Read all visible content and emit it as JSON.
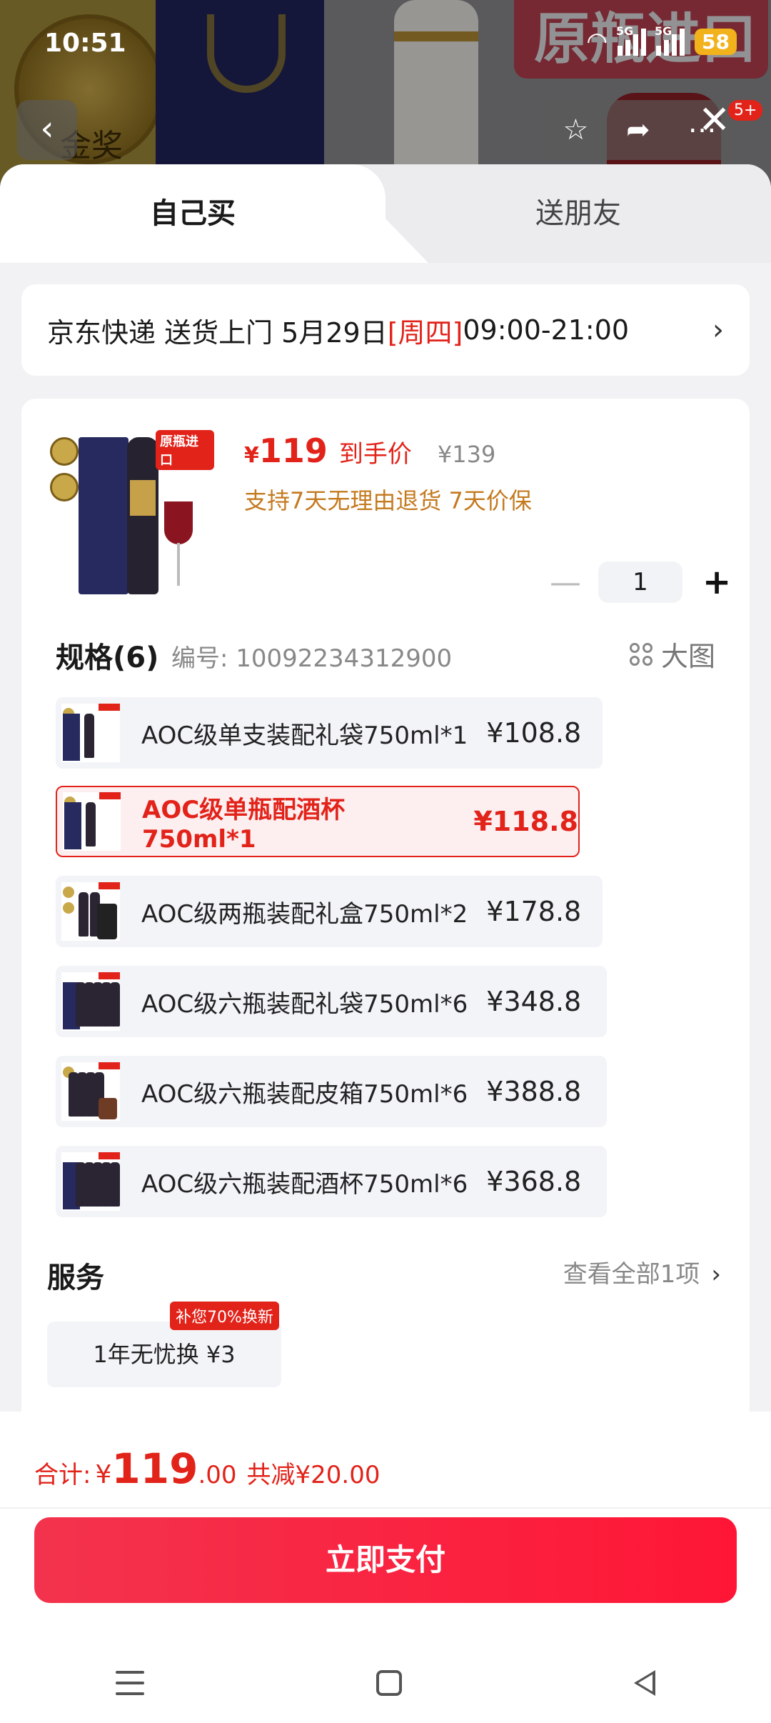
{
  "status_bar": {
    "time": "10:51",
    "battery": "58",
    "signal_labels": [
      "5G",
      "5G"
    ]
  },
  "background": {
    "badge_text": "原瓶进口",
    "medal_text": "金奖",
    "cart_count": "5+"
  },
  "tabs": [
    {
      "label": "自己买",
      "active": true
    },
    {
      "label": "送朋友",
      "active": false
    }
  ],
  "delivery": {
    "prefix": "京东快递 送货上门 5月29日 ",
    "weekday": "[周四]",
    "time_window": " 09:00-21:00"
  },
  "product": {
    "image_tag": "原瓶进口",
    "price_symbol": "¥",
    "price": "119",
    "price_note": "到手价",
    "original_price": "¥139",
    "guarantee": "支持7天无理由退货 7天价保",
    "quantity": "1"
  },
  "spec": {
    "title": "规格(6)",
    "code": "编号: 10092234312900",
    "big_image_label": "大图",
    "options": [
      {
        "name": "AOC级单支装配礼袋750ml*1",
        "price": "¥108.8",
        "selected": false
      },
      {
        "name": "AOC级单瓶配酒杯750ml*1",
        "price": "¥118.8",
        "selected": true
      },
      {
        "name": "AOC级两瓶装配礼盒750ml*2",
        "price": "¥178.8",
        "selected": false
      },
      {
        "name": "AOC级六瓶装配礼袋750ml*6",
        "price": "¥348.8",
        "selected": false
      },
      {
        "name": "AOC级六瓶装配皮箱750ml*6",
        "price": "¥388.8",
        "selected": false
      },
      {
        "name": "AOC级六瓶装配酒杯750ml*6",
        "price": "¥368.8",
        "selected": false
      }
    ]
  },
  "service": {
    "title": "服务",
    "view_all": "查看全部1项",
    "item": "1年无忧换 ¥3",
    "badge": "补您70%换新"
  },
  "summary": {
    "label": "合计:",
    "currency": "¥",
    "integer": "119",
    "decimal": ".00",
    "saving": "共减¥20.00"
  },
  "pay_button": "立即支付",
  "colors": {
    "accent": "#e2231a",
    "guarantee": "#c47a1f",
    "pay_start": "#f3334d",
    "pay_end": "#ff1636"
  }
}
